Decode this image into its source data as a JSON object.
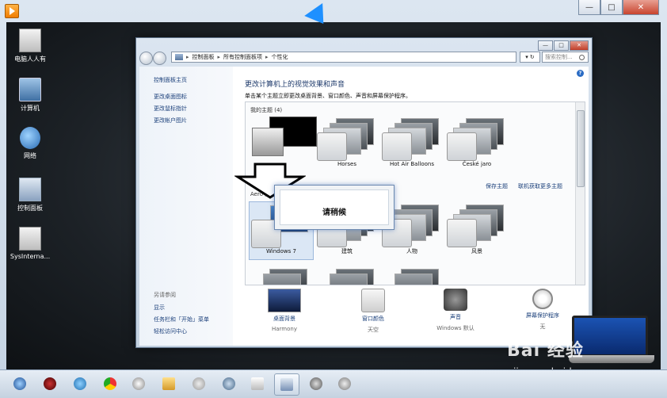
{
  "host_window": {
    "minimize": "—",
    "maximize": "□",
    "close": "✕"
  },
  "desktop_icons": [
    {
      "label": "电脑人人有",
      "icon": "user-folder-icon"
    },
    {
      "label": "计算机",
      "icon": "computer-icon"
    },
    {
      "label": "网络",
      "icon": "network-icon"
    },
    {
      "label": "控制面板",
      "icon": "control-panel-icon"
    },
    {
      "label": "SysInterna...",
      "icon": "folder-icon"
    }
  ],
  "window": {
    "minimize": "—",
    "maximize": "□",
    "close": "✕",
    "breadcrumbs": [
      "控制面板",
      "所有控制面板项",
      "个性化"
    ],
    "search_placeholder": "搜索控制...",
    "sidebar": {
      "links": [
        "控制面板主页",
        "更改桌面图标",
        "更改鼠标指针",
        "更改帐户图片"
      ],
      "see_also_title": "另请参阅",
      "see_also": [
        "显示",
        "任务栏和「开始」菜单",
        "轻松访问中心"
      ]
    },
    "heading": "更改计算机上的视觉效果和声音",
    "subheading": "单击某个主题立即更改桌面背景、窗口颜色、声音和屏幕保护程序。",
    "my_themes": {
      "label": "我的主题 (4)",
      "items": [
        "",
        "Horses",
        "Hot Air Balloons",
        "České jaro"
      ],
      "save_link": "保存主题",
      "more_link": "联机获取更多主题"
    },
    "aero_themes": {
      "label": "Aero 主题",
      "items": [
        "Windows 7",
        "建筑",
        "人物",
        "风景"
      ]
    },
    "bottom": [
      {
        "label": "桌面背景",
        "value": "Harmony",
        "icon": "desktop-background-icon"
      },
      {
        "label": "窗口颜色",
        "value": "天空",
        "icon": "window-color-icon"
      },
      {
        "label": "声音",
        "value": "Windows 默认",
        "icon": "sound-icon"
      },
      {
        "label": "屏幕保护程序",
        "value": "无",
        "icon": "screensaver-icon"
      }
    ]
  },
  "dialog": {
    "text": "请稍候"
  },
  "taskbar": {
    "items": [
      "start-orb-icon",
      "app-icon",
      "ie-icon",
      "chrome-icon",
      "media-player-icon",
      "explorer-icon",
      "tool-icon",
      "browser-icon",
      "doc-icon",
      "control-panel-taskbar-icon",
      "dragon-icon",
      "tool2-icon"
    ]
  },
  "watermark": {
    "logo": "Bai 经验",
    "url": "jingyan.baidu.com"
  }
}
